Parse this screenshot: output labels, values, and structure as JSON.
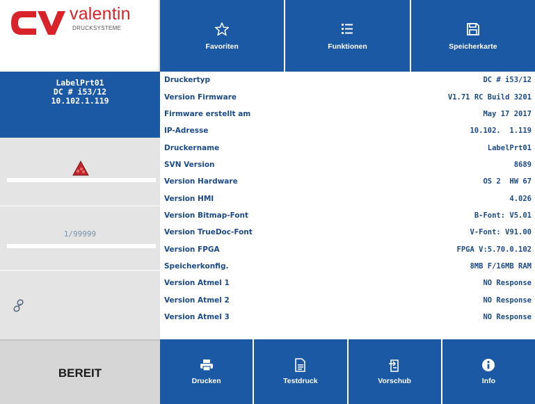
{
  "logo": {
    "mark": "CV",
    "name": "valentin",
    "subtitle": "DRUCKSYSTEME",
    "colors": {
      "mark": "#d8232a",
      "mark_sub": "#1c59a4"
    }
  },
  "printer": {
    "name": "LabelPrt01",
    "type": "DC # i53/12",
    "ip": "10.102.1.119"
  },
  "status": {
    "warning_icon": "warning-triangle-icon",
    "counter": "1/99999",
    "link_icon": "link-icon",
    "state": "BEREIT"
  },
  "toolbar": {
    "favorites": {
      "label": "Favoriten",
      "icon": "star-icon"
    },
    "functions": {
      "label": "Funktionen",
      "icon": "list-icon"
    },
    "memory_card": {
      "label": "Speicherkarte",
      "icon": "floppy-icon"
    }
  },
  "info_rows": [
    {
      "label": "Druckertyp",
      "value": "DC # i53/12"
    },
    {
      "label": "Version Firmware",
      "value": "V1.71 RC Build 3201"
    },
    {
      "label": "Firmware erstellt am",
      "value": "May 17 2017"
    },
    {
      "label": "IP-Adresse",
      "value": "10.102.  1.119"
    },
    {
      "label": "Druckername",
      "value": "LabelPrt01"
    },
    {
      "label": "SVN Version",
      "value": "8689"
    },
    {
      "label": "Version Hardware",
      "value": "OS 2  HW 67"
    },
    {
      "label": "Version HMI",
      "value": "4.026"
    },
    {
      "label": "Version Bitmap-Font",
      "value": "B-Font: V5.01"
    },
    {
      "label": "Version TrueDoc-Font",
      "value": "V-Font: V91.00"
    },
    {
      "label": "Version FPGA",
      "value": "FPGA V:5.70.0.102"
    },
    {
      "label": "Speicherkonfig.",
      "value": "8MB F/16MB RAM"
    },
    {
      "label": "Version Atmel 1",
      "value": "NO Response"
    },
    {
      "label": "Version Atmel 2",
      "value": "NO Response"
    },
    {
      "label": "Version Atmel 3",
      "value": "NO Response"
    }
  ],
  "bottombar": {
    "print": {
      "label": "Drucken",
      "icon": "printer-icon"
    },
    "test_print": {
      "label": "Testdruck",
      "icon": "test-print-icon"
    },
    "feed": {
      "label": "Vorschub",
      "icon": "feed-icon"
    },
    "info": {
      "label": "Info",
      "icon": "info-icon"
    }
  },
  "colors": {
    "primary_blue": "#1c59a4",
    "text_blue": "#1c4a86",
    "panel_gray": "#e4e4e4",
    "ready_gray": "#d6d6d6",
    "warning_red": "#c0272d"
  }
}
